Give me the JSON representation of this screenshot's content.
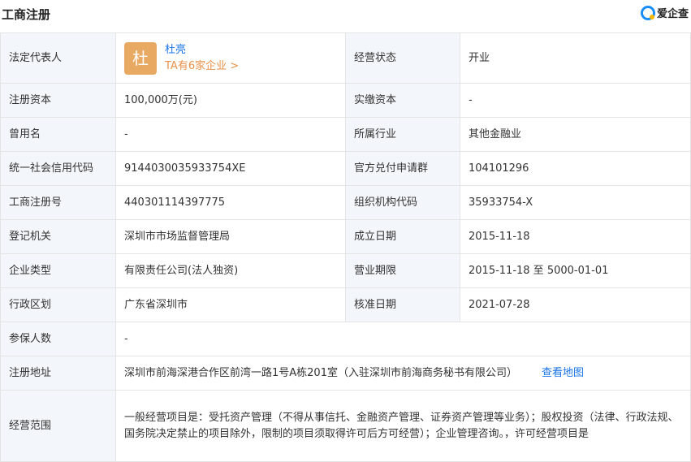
{
  "header": {
    "title": "工商注册",
    "logo_text": "爱企查",
    "logo_color": "#1a8ffb"
  },
  "legal_rep": {
    "label": "法定代表人",
    "avatar_char": "杜",
    "name": "杜亮",
    "sub": "TA有6家企业 >"
  },
  "status": {
    "label": "经营状态",
    "value": "开业"
  },
  "reg_capital": {
    "label": "注册资本",
    "value": "100,000万(元)"
  },
  "paid_capital": {
    "label": "实缴资本",
    "value": "-"
  },
  "former_name": {
    "label": "曾用名",
    "value": "-"
  },
  "industry": {
    "label": "所属行业",
    "value": "其他金融业"
  },
  "credit_code": {
    "label": "统一社会信用代码",
    "value": "9144030035933754XE"
  },
  "official_group": {
    "label": "官方兑付申请群",
    "value": "104101296"
  },
  "reg_no": {
    "label": "工商注册号",
    "value": "440301114397775"
  },
  "org_code": {
    "label": "组织机构代码",
    "value": "35933754-X"
  },
  "authority": {
    "label": "登记机关",
    "value": "深圳市市场监督管理局"
  },
  "established": {
    "label": "成立日期",
    "value": "2015-11-18"
  },
  "company_type": {
    "label": "企业类型",
    "value": "有限责任公司(法人独资)"
  },
  "term": {
    "label": "营业期限",
    "value": "2015-11-18 至 5000-01-01"
  },
  "region": {
    "label": "行政区划",
    "value": "广东省深圳市"
  },
  "approval_date": {
    "label": "核准日期",
    "value": "2021-07-28"
  },
  "insured": {
    "label": "参保人数",
    "value": "-"
  },
  "address": {
    "label": "注册地址",
    "value": "深圳市前海深港合作区前湾一路1号A栋201室（入驻深圳市前海商务秘书有限公司）",
    "map_link": "查看地图"
  },
  "scope": {
    "label": "经营范围",
    "value": "一般经营项目是：受托资产管理（不得从事信托、金融资产管理、证券资产管理等业务）；股权投资（法律、行政法规、国务院决定禁止的项目除外，限制的项目须取得许可后方可经营）；企业管理咨询。，许可经营项目是"
  }
}
